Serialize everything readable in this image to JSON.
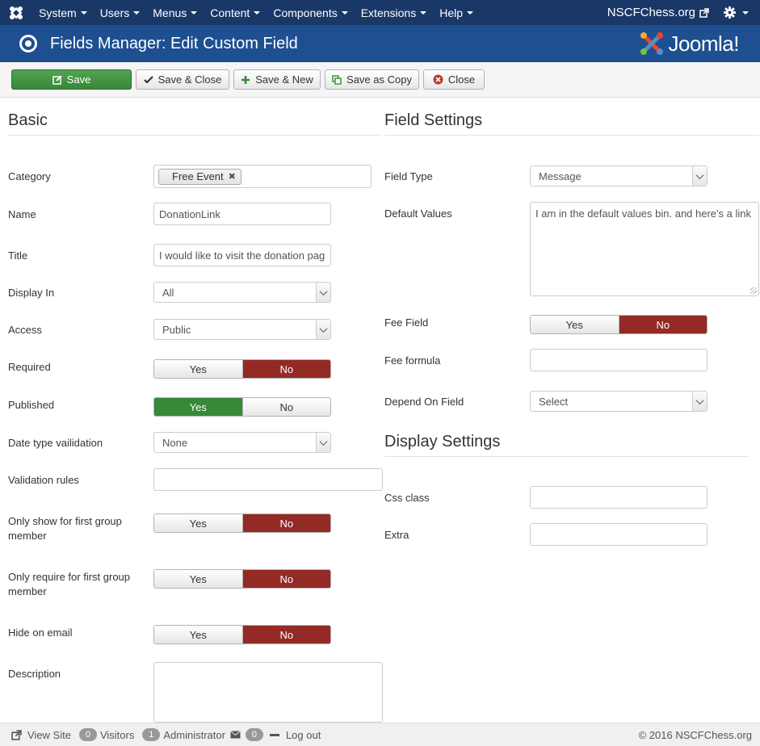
{
  "topnav": {
    "menu": [
      "System",
      "Users",
      "Menus",
      "Content",
      "Components",
      "Extensions",
      "Help"
    ],
    "site_link": "NSCFChess.org"
  },
  "header": {
    "title": "Fields Manager: Edit Custom Field",
    "brand": "Joomla!"
  },
  "toolbar": {
    "save": "Save",
    "save_close": "Save & Close",
    "save_new": "Save & New",
    "save_copy": "Save as Copy",
    "close": "Close"
  },
  "basic": {
    "title": "Basic",
    "category_label": "Category",
    "category_tag": "Free Event",
    "name_label": "Name",
    "name_value": "DonationLink",
    "title_label": "Title",
    "title_value": "I would like to visit the donation pag",
    "display_in_label": "Display In",
    "display_in_value": "All",
    "access_label": "Access",
    "access_value": "Public",
    "required_label": "Required",
    "published_label": "Published",
    "date_validation_label": "Date type vailidation",
    "date_validation_value": "None",
    "validation_rules_label": "Validation rules",
    "validation_rules_value": "",
    "first_group_show_label": "Only show for first group member",
    "first_group_require_label": "Only require for first group member",
    "hide_email_label": "Hide on email",
    "description_label": "Description",
    "yes": "Yes",
    "no": "No"
  },
  "field_settings": {
    "title": "Field Settings",
    "field_type_label": "Field Type",
    "field_type_value": "Message",
    "default_values_label": "Default Values",
    "default_values_value": "I am in the default values bin. and here's a link",
    "fee_field_label": "Fee Field",
    "fee_formula_label": "Fee formula",
    "fee_formula_value": "",
    "depend_label": "Depend On Field",
    "depend_value": "Select"
  },
  "display_settings": {
    "title": "Display Settings",
    "css_label": "Css class",
    "css_value": "",
    "extra_label": "Extra",
    "extra_value": ""
  },
  "footer": {
    "view_site": "View Site",
    "visitors_count": "0",
    "visitors": "Visitors",
    "admin_count": "1",
    "administrator": "Administrator",
    "messages_count": "0",
    "logout": "Log out",
    "copyright": "© 2016 NSCFChess.org"
  }
}
